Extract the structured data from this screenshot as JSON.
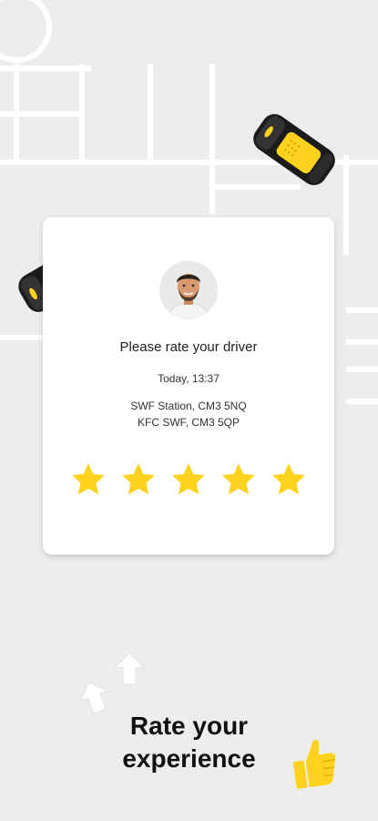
{
  "card": {
    "title": "Please rate your driver",
    "time": "Today, 13:37",
    "pickup": "SWF Station, CM3 5NQ",
    "dropoff": "KFC SWF, CM3 5QP",
    "stars": [
      {
        "name": "star-1"
      },
      {
        "name": "star-2"
      },
      {
        "name": "star-3"
      },
      {
        "name": "star-4"
      },
      {
        "name": "star-5"
      }
    ],
    "rating": 5
  },
  "headline": {
    "line1": "Rate your",
    "line2": "experience"
  },
  "colors": {
    "accent": "#FFD21E",
    "background": "#EDEDED",
    "card": "#FFFFFF",
    "text": "#111111"
  },
  "icons": [
    "car-icon",
    "avatar",
    "star-icon",
    "arrow-up-icon",
    "thumbs-up-icon"
  ]
}
